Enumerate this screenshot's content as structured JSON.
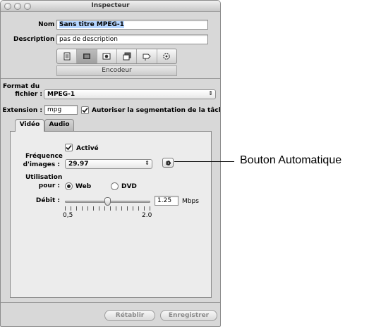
{
  "window": {
    "title": "Inspecteur"
  },
  "header": {
    "name_label": "Nom :",
    "name_value": "Sans titre MPEG-1",
    "description_label": "Description :",
    "description_value": "pas de description"
  },
  "toolbar": {
    "buttons": [
      {
        "icon": "summary-icon"
      },
      {
        "icon": "encoder-icon",
        "active": true
      },
      {
        "icon": "filters-icon"
      },
      {
        "icon": "geometry-icon"
      },
      {
        "icon": "actions-icon"
      },
      {
        "icon": "settings-gear-icon"
      }
    ],
    "section_label": "Encodeur"
  },
  "format": {
    "label_line1": "Format du",
    "label_line2": "fichier :",
    "value": "MPEG-1"
  },
  "extension": {
    "label": "Extension :",
    "value": "mpg",
    "segmentation_label": "Autoriser la segmentation de la tâche",
    "segmentation_checked": true
  },
  "tabs": [
    {
      "label": "Vidéo",
      "active": true
    },
    {
      "label": "Audio",
      "active": false
    }
  ],
  "video": {
    "enabled_label": "Activé",
    "enabled_checked": true,
    "framerate_label_line1": "Fréquence",
    "framerate_label_line2": "d'images :",
    "framerate_value": "29.97",
    "usage_label_line1": "Utilisation",
    "usage_label_line2": "pour :",
    "usage_web": "Web",
    "usage_dvd": "DVD",
    "usage_selected": "Web",
    "bitrate_label": "Débit :",
    "bitrate_value": "1.25",
    "bitrate_unit": "Mbps",
    "slider_min_label": "0,5",
    "slider_max_label": "2.0",
    "slider_min": 0.5,
    "slider_max": 2.0,
    "slider_value": 1.25
  },
  "footer": {
    "revert_label": "Rétablir",
    "save_label": "Enregistrer"
  },
  "callout": {
    "text": "Bouton Automatique"
  }
}
